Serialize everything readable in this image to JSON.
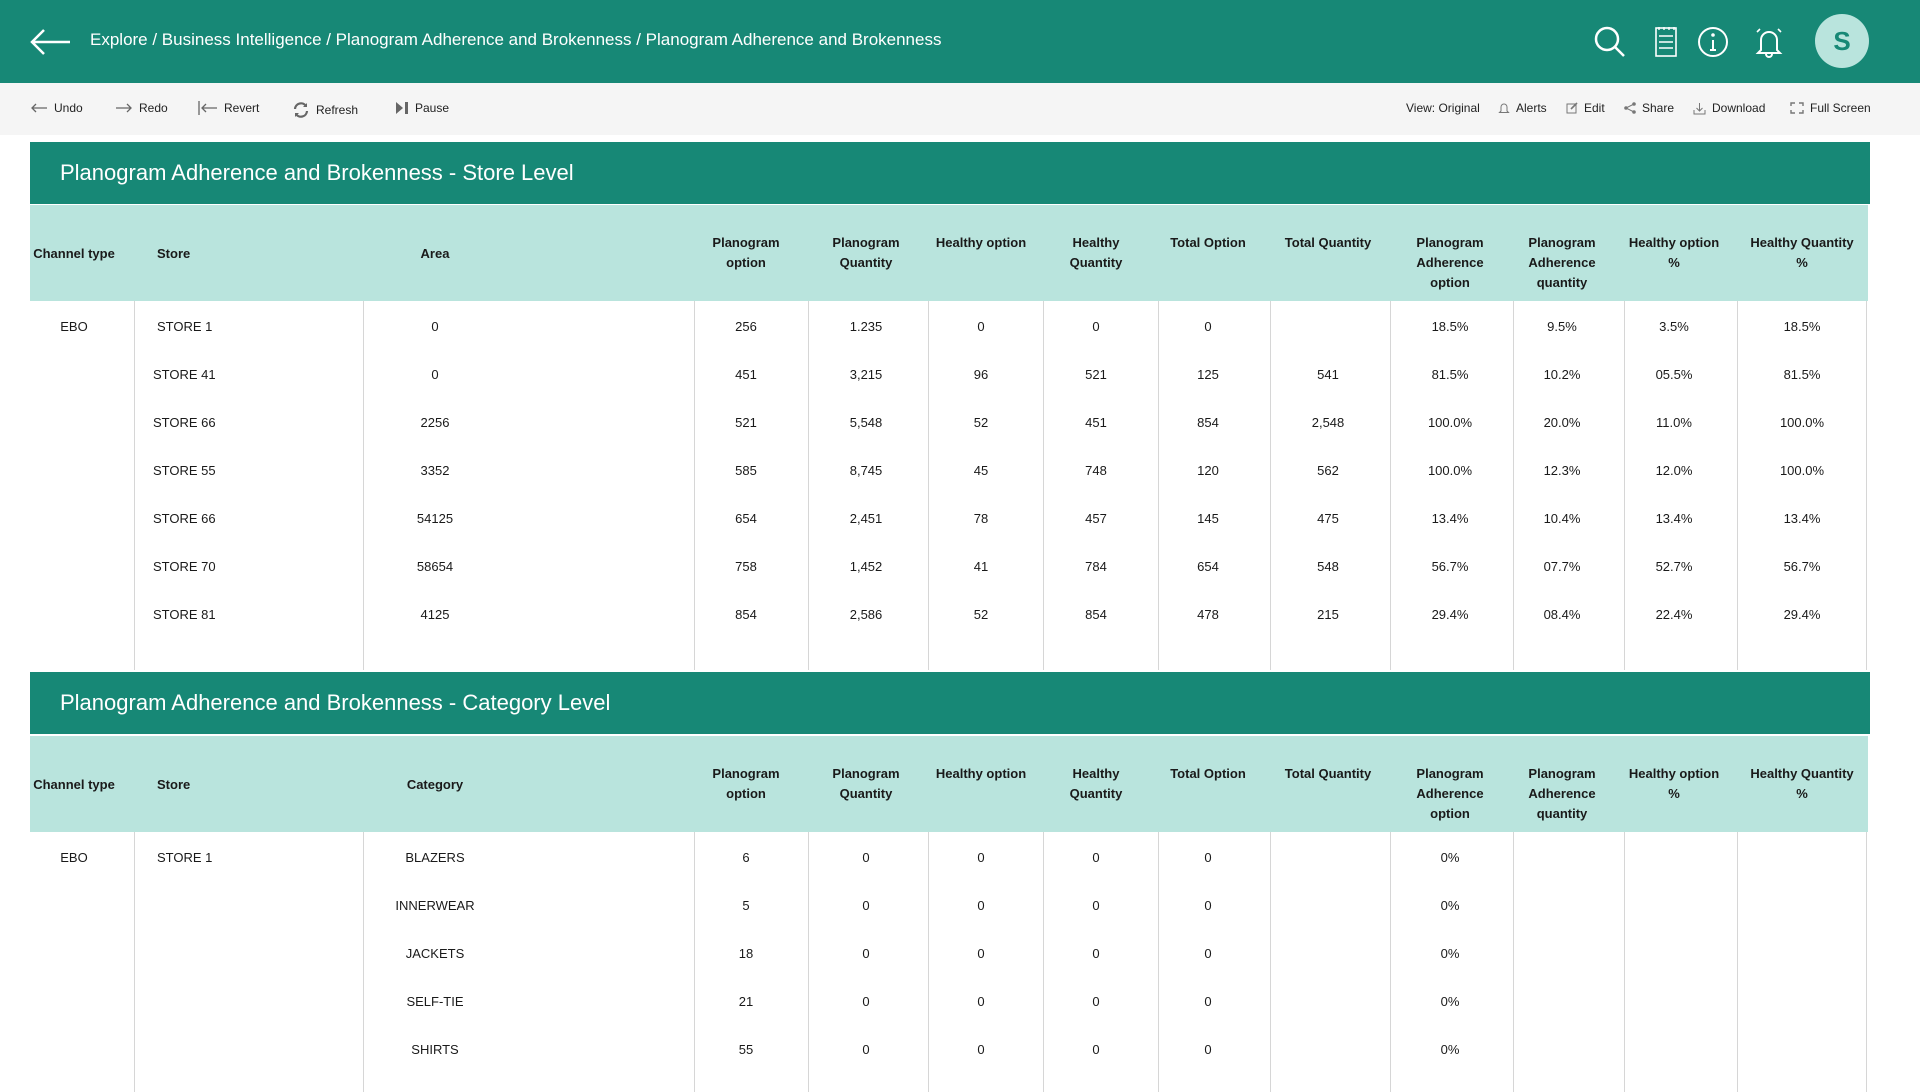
{
  "header": {
    "breadcrumb": "Explore / Business Intelligence / Planogram Adherence and Brokenness / Planogram Adherence and Brokenness",
    "avatar_initial": "S",
    "icons": [
      "search-icon",
      "checklist-icon",
      "info-icon",
      "bell-icon"
    ]
  },
  "toolbar": {
    "left": [
      {
        "label": "Undo",
        "icon": "arrow-left-icon"
      },
      {
        "label": "Redo",
        "icon": "arrow-right-icon"
      },
      {
        "label": "Revert",
        "icon": "revert-icon"
      },
      {
        "label": "Refresh",
        "icon": "refresh-icon"
      },
      {
        "label": "Pause",
        "icon": "pause-icon"
      }
    ],
    "right": [
      {
        "label": "View: Original",
        "icon": ""
      },
      {
        "label": "Alerts",
        "icon": "bell-icon"
      },
      {
        "label": "Edit",
        "icon": "edit-icon"
      },
      {
        "label": "Share",
        "icon": "share-icon"
      },
      {
        "label": "Download",
        "icon": "download-icon"
      },
      {
        "label": "Full Screen",
        "icon": "fullscreen-icon"
      }
    ]
  },
  "store_table": {
    "title": "Planogram Adherence and Brokenness - Store Level",
    "columns": [
      "Channel type",
      "Store",
      "Area",
      "Planogram option",
      "Planogram Quantity",
      "Healthy option",
      "Healthy Quantity",
      "Total Option",
      "Total Quantity",
      "Planogram Adherence option",
      "Planogram Adherence quantity",
      "Healthy option %",
      "Healthy Quantity %"
    ],
    "rows": [
      [
        "EBO",
        "STORE 1",
        "0",
        "256",
        "1.235",
        "0",
        "0",
        "0",
        "",
        "18.5%",
        "9.5%",
        "3.5%",
        "18.5%"
      ],
      [
        "",
        "STORE 41",
        "0",
        "451",
        "3,215",
        "96",
        "521",
        "125",
        "541",
        "81.5%",
        "10.2%",
        "05.5%",
        "81.5%"
      ],
      [
        "",
        "STORE 66",
        "2256",
        "521",
        "5,548",
        "52",
        "451",
        "854",
        "2,548",
        "100.0%",
        "20.0%",
        "11.0%",
        "100.0%"
      ],
      [
        "",
        "STORE 55",
        "3352",
        "585",
        "8,745",
        "45",
        "748",
        "120",
        "562",
        "100.0%",
        "12.3%",
        "12.0%",
        "100.0%"
      ],
      [
        "",
        "STORE 66",
        "54125",
        "654",
        "2,451",
        "78",
        "457",
        "145",
        "475",
        "13.4%",
        "10.4%",
        "13.4%",
        "13.4%"
      ],
      [
        "",
        "STORE 70",
        "58654",
        "758",
        "1,452",
        "41",
        "784",
        "654",
        "548",
        "56.7%",
        "07.7%",
        "52.7%",
        "56.7%"
      ],
      [
        "",
        "STORE 81",
        "4125",
        "854",
        "2,586",
        "52",
        "854",
        "478",
        "215",
        "29.4%",
        "08.4%",
        "22.4%",
        "29.4%"
      ]
    ]
  },
  "category_table": {
    "title": "Planogram Adherence and Brokenness - Category Level",
    "columns": [
      "Channel type",
      "Store",
      "Category",
      "Planogram option",
      "Planogram Quantity",
      "Healthy option",
      "Healthy Quantity",
      "Total Option",
      "Total Quantity",
      "Planogram Adherence option",
      "Planogram Adherence quantity",
      "Healthy option %",
      "Healthy Quantity %"
    ],
    "rows": [
      [
        "EBO",
        "STORE 1",
        "BLAZERS",
        "6",
        "0",
        "0",
        "0",
        "0",
        "",
        "0%",
        "",
        "",
        ""
      ],
      [
        "",
        "",
        "INNERWEAR",
        "5",
        "0",
        "0",
        "0",
        "0",
        "",
        "0%",
        "",
        "",
        ""
      ],
      [
        "",
        "",
        "JACKETS",
        "18",
        "0",
        "0",
        "0",
        "0",
        "",
        "0%",
        "",
        "",
        ""
      ],
      [
        "",
        "",
        "SELF-TIE",
        "21",
        "0",
        "0",
        "0",
        "0",
        "",
        "0%",
        "",
        "",
        ""
      ],
      [
        "",
        "",
        "SHIRTS",
        "55",
        "0",
        "0",
        "0",
        "0",
        "",
        "0%",
        "",
        "",
        ""
      ]
    ]
  }
}
